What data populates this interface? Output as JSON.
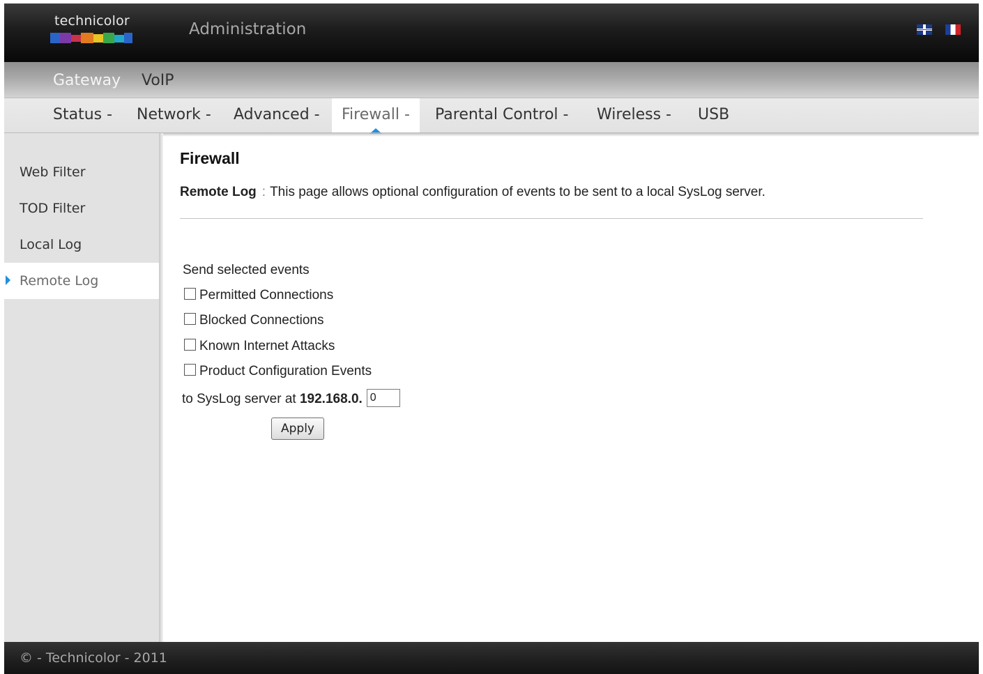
{
  "header": {
    "logo_text": "technicolor",
    "title": "Administration",
    "languages": [
      "English",
      "Français"
    ]
  },
  "topnav": {
    "items": [
      "Gateway",
      "VoIP"
    ],
    "active": "Gateway"
  },
  "subnav": {
    "items": [
      "Status -",
      "Network -",
      "Advanced -",
      "Firewall -",
      "Parental Control -",
      "Wireless -",
      "USB"
    ],
    "active": "Firewall -"
  },
  "sidebar": {
    "items": [
      "Web Filter",
      "TOD Filter",
      "Local Log",
      "Remote Log"
    ],
    "active": "Remote Log"
  },
  "main": {
    "title": "Firewall",
    "section_name": "Remote Log",
    "separator": ":",
    "description": "This page allows optional configuration of events to be sent to a local SysLog server.",
    "events_label": "Send selected events",
    "events": [
      {
        "label": "Permitted Connections",
        "checked": false
      },
      {
        "label": "Blocked Connections",
        "checked": false
      },
      {
        "label": "Known Internet Attacks",
        "checked": false
      },
      {
        "label": "Product Configuration Events",
        "checked": false
      }
    ],
    "syslog_prefix": "to SysLog server at",
    "ip_prefix": "192.168.0.",
    "ip_last_octet": "0",
    "apply_label": "Apply"
  },
  "footer": {
    "text": "© - Technicolor - 2011"
  },
  "colors": {
    "accent": "#1f8fe0",
    "header_bg": "#0a0a0a",
    "sidebar_bg": "#e2e2e2"
  }
}
